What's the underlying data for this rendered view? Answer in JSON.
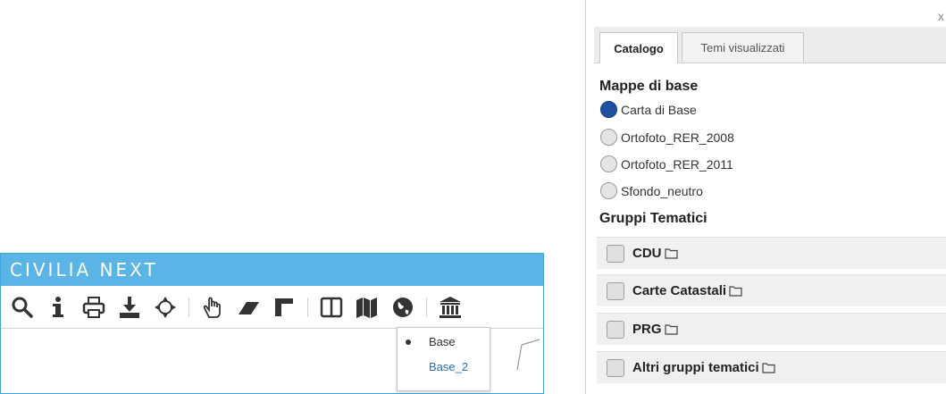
{
  "app": {
    "title": "CIVILIA NEXT",
    "toolbar": {
      "tools": [
        "search-icon",
        "info-icon",
        "print-icon",
        "download-icon",
        "locate-icon",
        "pan-hand-icon",
        "eraser-icon",
        "measure-icon",
        "split-view-icon",
        "base-map-icon",
        "globe-icon",
        "building-icon"
      ]
    },
    "base_menu": {
      "items": [
        {
          "label": "Base",
          "selected": true
        },
        {
          "label": "Base_2",
          "selected": false
        }
      ]
    }
  },
  "catalog": {
    "close_label": "x",
    "tabs": [
      {
        "label": "Catalogo",
        "active": true
      },
      {
        "label": "Temi visualizzati",
        "active": false
      }
    ],
    "base_maps_title": "Mappe di base",
    "base_maps": [
      {
        "label": "Carta di Base",
        "selected": true
      },
      {
        "label": "Ortofoto_RER_2008",
        "selected": false
      },
      {
        "label": "Ortofoto_RER_2011",
        "selected": false
      },
      {
        "label": "Sfondo_neutro",
        "selected": false
      }
    ],
    "groups_title": "Gruppi Tematici",
    "groups": [
      {
        "label": "CDU",
        "checked": false
      },
      {
        "label": "Carte Catastali",
        "checked": false
      },
      {
        "label": "PRG",
        "checked": false
      },
      {
        "label": "Altri gruppi tematici",
        "checked": false
      }
    ]
  },
  "colors": {
    "header": "#5ab4e5",
    "radio_selected": "#1e4fa0",
    "link": "#2a6db5"
  }
}
